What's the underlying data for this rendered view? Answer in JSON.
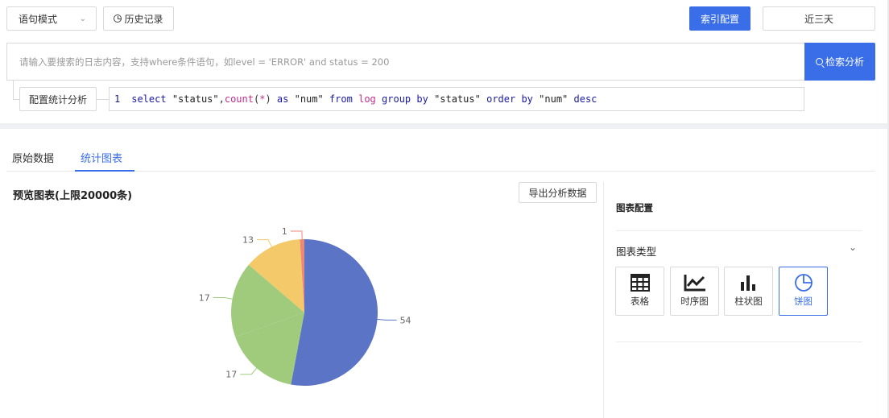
{
  "toolbar": {
    "mode_label": "语句模式",
    "history_label": "历史记录",
    "index_config_label": "索引配置",
    "time_range_label": "近三天"
  },
  "search": {
    "placeholder": "请输入要搜索的日志内容，支持where条件语句，如level = 'ERROR' and status = 200",
    "search_button_label": "检索分析"
  },
  "analysis": {
    "config_button_label": "配置统计分析",
    "line_number": "1",
    "tokens": [
      {
        "t": "select",
        "c": "kw"
      },
      {
        "t": " ",
        "c": "plain"
      },
      {
        "t": "\"status\"",
        "c": "str"
      },
      {
        "t": ",",
        "c": "plain"
      },
      {
        "t": "count",
        "c": "fn"
      },
      {
        "t": "(",
        "c": "plain"
      },
      {
        "t": "*",
        "c": "fn"
      },
      {
        "t": ") ",
        "c": "plain"
      },
      {
        "t": "as",
        "c": "kw"
      },
      {
        "t": " ",
        "c": "plain"
      },
      {
        "t": "\"num\"",
        "c": "str"
      },
      {
        "t": " ",
        "c": "plain"
      },
      {
        "t": "from",
        "c": "kw"
      },
      {
        "t": " ",
        "c": "plain"
      },
      {
        "t": "log",
        "c": "fn"
      },
      {
        "t": " ",
        "c": "plain"
      },
      {
        "t": "group",
        "c": "kw"
      },
      {
        "t": " ",
        "c": "plain"
      },
      {
        "t": "by",
        "c": "kw"
      },
      {
        "t": " ",
        "c": "plain"
      },
      {
        "t": "\"status\"",
        "c": "str"
      },
      {
        "t": " ",
        "c": "plain"
      },
      {
        "t": "order",
        "c": "kw"
      },
      {
        "t": " ",
        "c": "plain"
      },
      {
        "t": "by",
        "c": "kw"
      },
      {
        "t": " ",
        "c": "plain"
      },
      {
        "t": "\"num\"",
        "c": "str"
      },
      {
        "t": " ",
        "c": "plain"
      },
      {
        "t": "desc",
        "c": "kw"
      }
    ]
  },
  "tabs": [
    {
      "label": "原始数据",
      "active": false
    },
    {
      "label": "统计图表",
      "active": true
    }
  ],
  "preview": {
    "title": "预览图表(上限20000条)",
    "export_label": "导出分析数据"
  },
  "config_panel": {
    "title": "图表配置",
    "type_section_label": "图表类型",
    "types": [
      {
        "label": "表格",
        "icon": "table-icon",
        "active": false
      },
      {
        "label": "时序图",
        "icon": "line-chart-icon",
        "active": false
      },
      {
        "label": "柱状图",
        "icon": "bar-chart-icon",
        "active": false
      },
      {
        "label": "饼图",
        "icon": "pie-chart-icon",
        "active": true
      }
    ]
  },
  "colors": {
    "accent": "#3a6ee8"
  },
  "chart_data": {
    "type": "pie",
    "values": [
      54,
      17,
      17,
      13,
      1
    ],
    "labels": [
      "54",
      "17",
      "17",
      "13",
      "1"
    ],
    "colors": [
      "#5b74c5",
      "#a0cb7d",
      "#a0cb7d",
      "#f3c96a",
      "#ec8876"
    ]
  }
}
